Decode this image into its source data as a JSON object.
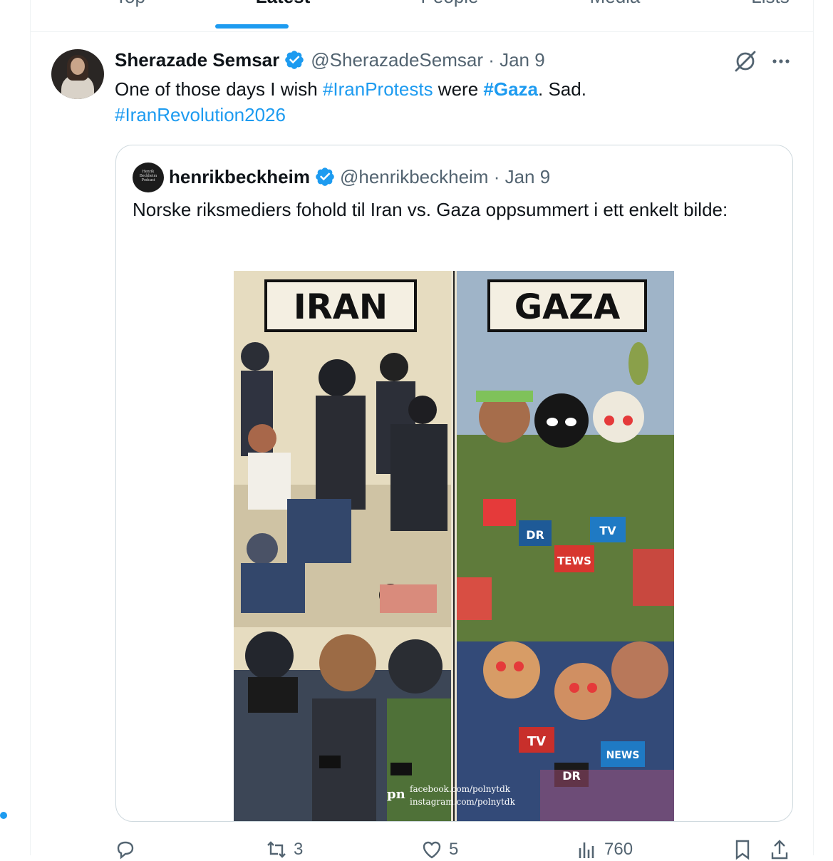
{
  "tabs": {
    "items": [
      {
        "label": "Top"
      },
      {
        "label": "Latest"
      },
      {
        "label": "People"
      },
      {
        "label": "Media"
      },
      {
        "label": "Lists"
      }
    ],
    "active": "Latest"
  },
  "post": {
    "author_name": "Sherazade Semsar",
    "handle_date": "@SherazadeSemsar · Jan 9",
    "text_1": "One of those days I wish ",
    "tag_1": "#IranProtests",
    "text_2": " were ",
    "tag_2": "#Gaza",
    "text_3": ". Sad.",
    "tag_3": "#IranRevolution2026"
  },
  "quote": {
    "author_name": "henrikbeckheim",
    "handle_date": "@henrikbeckheim · Jan 9",
    "text": "Norske riksmediers fohold til Iran vs. Gaza oppsummert i ett enkelt bilde:",
    "avatar_text": "Henrik Beckheim Podcast",
    "image": {
      "label_left": "IRAN",
      "label_right": "GAZA",
      "credit_logo": "pn",
      "credit_line_1": "facebook.com/polnytdk",
      "credit_line_2": "instagram.com/polnytdk",
      "mic_labels": [
        "DR",
        "TEWS",
        "TV",
        "TV",
        "DR",
        "NEWS"
      ]
    }
  },
  "actions": {
    "reply_count": "",
    "repost_count": "3",
    "like_count": "5",
    "views_count": "760"
  },
  "colors": {
    "accent": "#1d9bf0",
    "text": "#0f1419",
    "muted": "#536471",
    "border": "#cfd9de"
  }
}
